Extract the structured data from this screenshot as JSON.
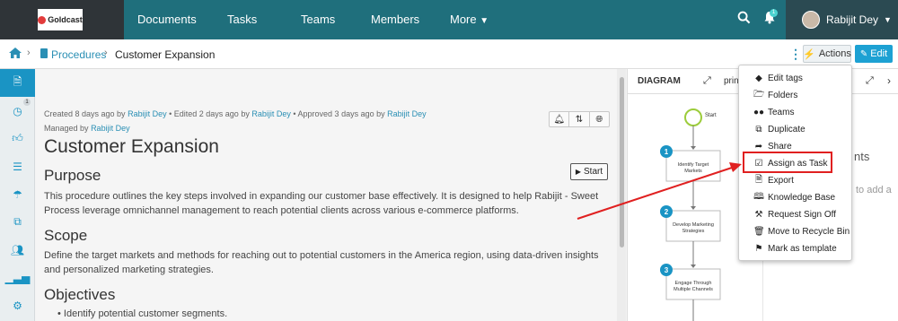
{
  "brand": {
    "logo_text": "Goldcast"
  },
  "nav": {
    "items": [
      "Documents",
      "Tasks",
      "Teams",
      "Members",
      "More"
    ],
    "notification_count": "1",
    "user_name": "Rabijit Dey"
  },
  "breadcrumb": {
    "parent": "Procedures",
    "current": "Customer Expansion"
  },
  "toolbar": {
    "actions_label": "Actions",
    "edit_label": "Edit"
  },
  "sidebar": {
    "history_badge": "1"
  },
  "document": {
    "meta_created": "Created 8 days ago by",
    "meta_edited": "• Edited 2 days ago by",
    "meta_approved": "• Approved 3 days ago by",
    "meta_managed": "Managed by",
    "author": "Rabijit Dey",
    "title": "Customer Expansion",
    "start_label": "Start",
    "purpose_heading": "Purpose",
    "purpose_text": "This procedure outlines the key steps involved in expanding our customer base effectively. It is designed to help Rabijit - Sweet Process leverage omnichannel management to reach potential clients across various e-commerce platforms.",
    "scope_heading": "Scope",
    "scope_text": "Define the target markets and methods for reaching out to potential customers in the America region, using data-driven insights and personalized marketing strategies.",
    "objectives_heading": "Objectives",
    "objective_1": "Identify potential customer segments."
  },
  "diagram": {
    "title": "DIAGRAM",
    "print_label": "print",
    "start_label": "Start",
    "steps": [
      {
        "num": "1",
        "line1": "Identify Target",
        "line2": "Markets"
      },
      {
        "num": "2",
        "line1": "Develop Marketing",
        "line2": "Strategies"
      },
      {
        "num": "3",
        "line1": "Engage Through",
        "line2": "Multiple Channels"
      }
    ],
    "side_text_1": "nts",
    "side_text_2": "to add a"
  },
  "actions_menu": {
    "items": [
      {
        "label": "Edit tags",
        "icon": "tag-icon"
      },
      {
        "label": "Folders",
        "icon": "folder-icon"
      },
      {
        "label": "Teams",
        "icon": "users-icon"
      },
      {
        "label": "Duplicate",
        "icon": "copy-icon"
      },
      {
        "label": "Share",
        "icon": "share-icon"
      },
      {
        "label": "Assign as Task",
        "icon": "check-square-icon"
      },
      {
        "label": "Export",
        "icon": "file-icon"
      },
      {
        "label": "Knowledge Base",
        "icon": "book-icon"
      },
      {
        "label": "Request Sign Off",
        "icon": "gavel-icon"
      },
      {
        "label": "Move to Recycle Bin",
        "icon": "trash-icon"
      },
      {
        "label": "Mark as template",
        "icon": "bookmark-icon"
      }
    ]
  },
  "colors": {
    "nav_bg": "#1f6f7c",
    "accent": "#1a94c4",
    "highlight": "#e02020"
  }
}
